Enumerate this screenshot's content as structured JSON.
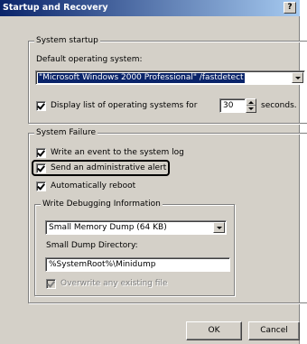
{
  "window": {
    "title": "Startup and Recovery",
    "help_label": "?"
  },
  "system_startup": {
    "legend": "System startup",
    "default_os_label": "Default operating system:",
    "default_os_value": "\"Microsoft Windows 2000 Professional\" /fastdetect",
    "display_list_label": "Display list of operating systems for",
    "display_list_checked": true,
    "seconds_value": "30",
    "seconds_label": "seconds."
  },
  "system_failure": {
    "legend": "System Failure",
    "write_event_label": "Write an event to the system log",
    "write_event_checked": true,
    "send_alert_label": "Send an administrative alert",
    "send_alert_checked": true,
    "auto_reboot_label": "Automatically reboot",
    "auto_reboot_checked": true,
    "debug": {
      "legend": "Write Debugging Information",
      "dump_type": "Small Memory Dump (64 KB)",
      "dir_label": "Small Dump Directory:",
      "dir_value": "%SystemRoot%\\Minidump",
      "overwrite_label": "Overwrite any existing file",
      "overwrite_checked": true,
      "overwrite_disabled": true
    }
  },
  "buttons": {
    "ok": "OK",
    "cancel": "Cancel"
  }
}
